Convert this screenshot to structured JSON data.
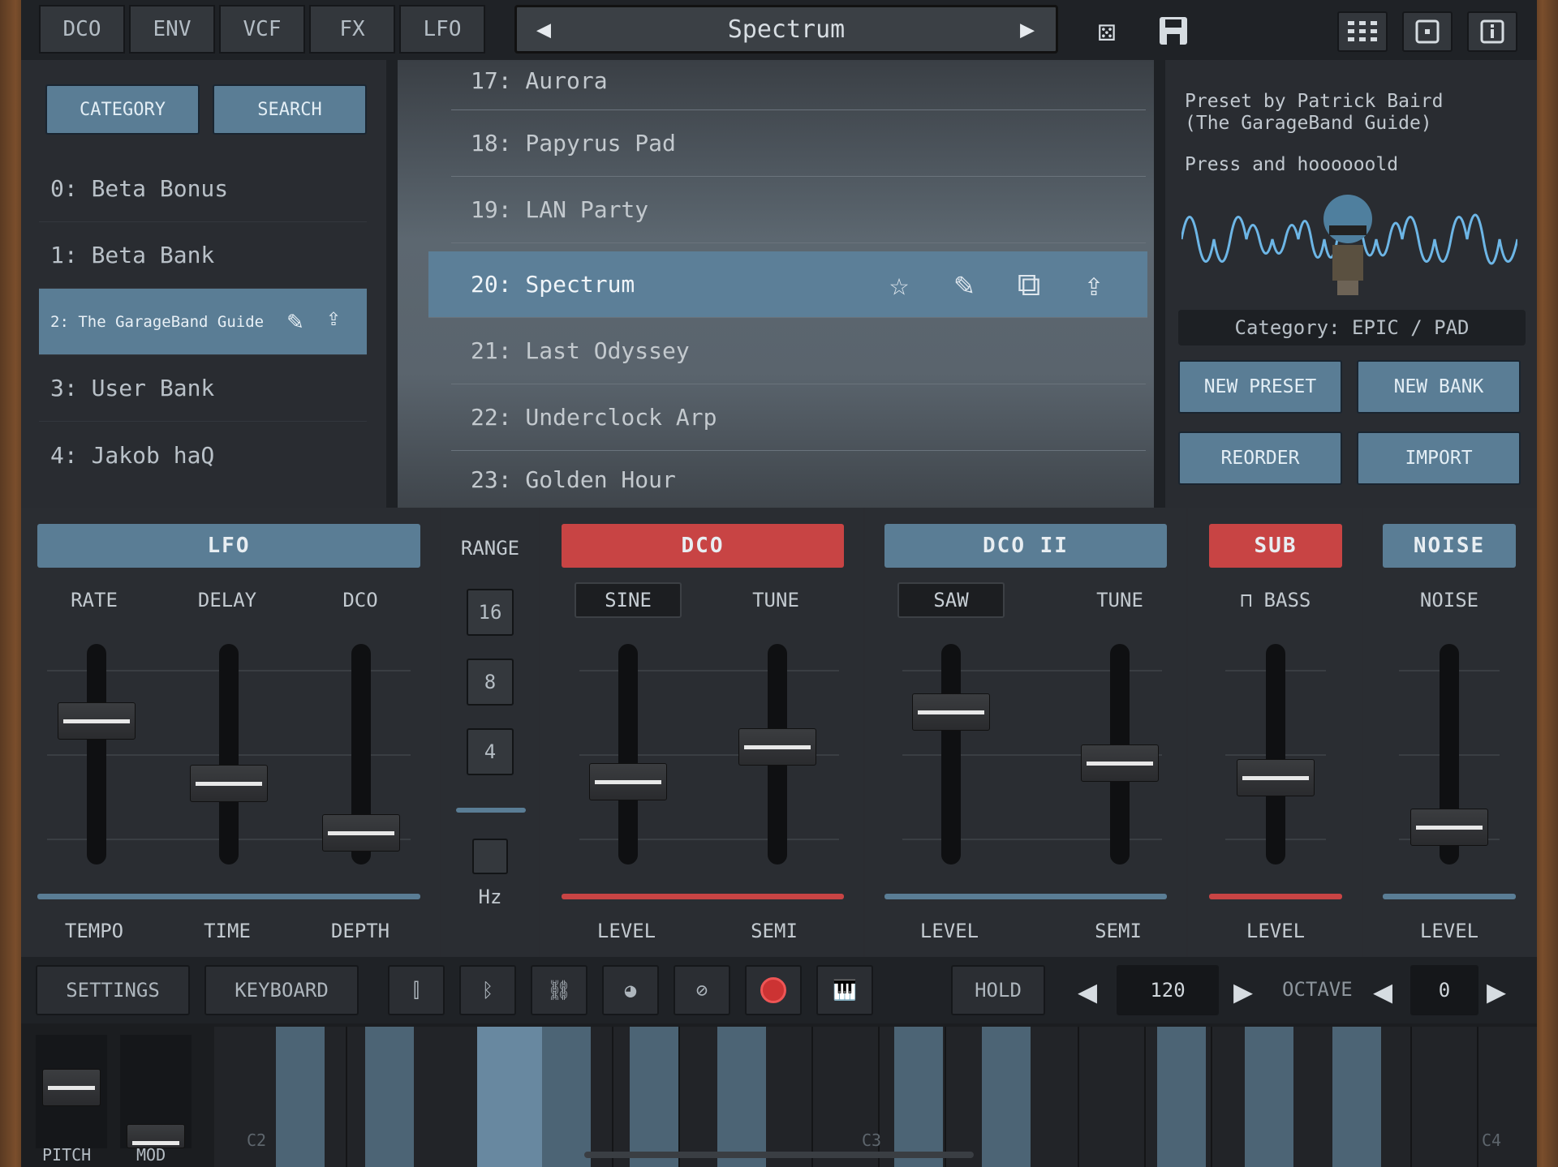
{
  "tabs": [
    "DCO",
    "ENV",
    "VCF",
    "FX",
    "LFO"
  ],
  "preset_name": "Spectrum",
  "browser": {
    "category_label": "CATEGORY",
    "search_label": "SEARCH"
  },
  "banks": [
    "0: Beta Bonus",
    "1: Beta Bank",
    "2: The GarageBand Guide",
    "3: User Bank",
    "4: Jakob haQ"
  ],
  "presets": [
    "17: Aurora",
    "18: Papyrus Pad",
    "19: LAN Party",
    "20: Spectrum",
    "21: Last Odyssey",
    "22: Underclock Arp",
    "23: Golden Hour"
  ],
  "info": {
    "line1": "Preset by Patrick Baird",
    "line2": "(The GarageBand Guide)",
    "line3": "Press and hoooooold",
    "category": "Category: EPIC / PAD"
  },
  "actions": {
    "new_preset": "NEW PRESET",
    "new_bank": "NEW BANK",
    "reorder": "REORDER",
    "import": "IMPORT"
  },
  "lfo": {
    "title": "LFO",
    "rate": "RATE",
    "delay": "DELAY",
    "dco": "DCO",
    "tempo": "TEMPO",
    "time": "TIME",
    "depth": "DEPTH"
  },
  "range": {
    "title": "RANGE",
    "values": [
      "16",
      "8",
      "4"
    ],
    "hz": "Hz"
  },
  "dco1": {
    "title": "DCO",
    "wave": "SINE",
    "tune": "TUNE",
    "level": "LEVEL",
    "semi": "SEMI"
  },
  "dco2": {
    "title": "DCO II",
    "wave": "SAW",
    "tune": "TUNE",
    "level": "LEVEL",
    "semi": "SEMI"
  },
  "sub": {
    "title": "SUB",
    "mode": "BASS",
    "level": "LEVEL"
  },
  "noise": {
    "title": "NOISE",
    "label": "NOISE",
    "level": "LEVEL"
  },
  "bottom": {
    "settings": "SETTINGS",
    "keyboard": "KEYBOARD",
    "hold": "HOLD",
    "tempo": "120",
    "octave_label": "OCTAVE",
    "octave": "0"
  },
  "keys": {
    "pitch": "PITCH",
    "mod": "MOD",
    "c2": "C2",
    "c3": "C3",
    "c4": "C4"
  },
  "sliders": {
    "lfo_rate": 0.68,
    "lfo_delay": 0.34,
    "lfo_depth": 0.07,
    "dco_level": 0.35,
    "dco_tune": 0.54,
    "dco2_level": 0.73,
    "dco2_semi": 0.45,
    "sub_level": 0.37,
    "noise_level": 0.1
  }
}
